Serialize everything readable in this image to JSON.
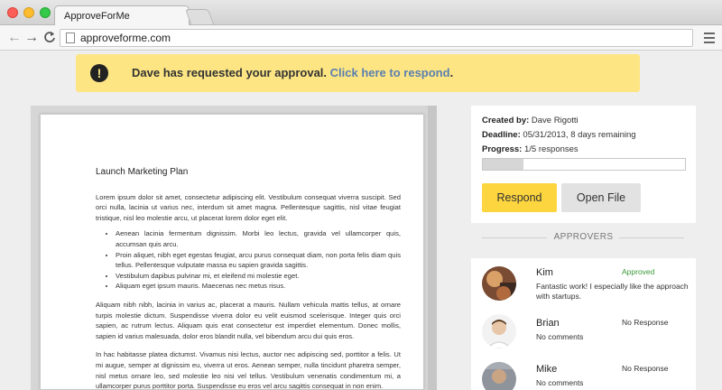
{
  "browser": {
    "tab_title": "ApproveForMe",
    "url": "approveforme.com"
  },
  "banner": {
    "text": "Dave has requested your approval. ",
    "link": "Click here to respond",
    "suffix": ".",
    "color": "#fde584"
  },
  "document": {
    "title": "Launch Marketing Plan",
    "para1": "Lorem ipsum dolor sit amet, consectetur adipiscing elit. Vestibulum consequat viverra suscipit. Sed orci nulla, lacinia ut varius nec, interdum sit amet magna. Pellentesque sagittis, nisl vitae feugiat tristique, nisl leo molestie arcu, ut placerat lorem dolor eget elit.",
    "bullets": [
      "Aenean lacinia fermentum dignissim. Morbi leo lectus, gravida vel ullamcorper quis, accumsan quis arcu.",
      "Proin aliquet, nibh eget egestas feugiat, arcu purus consequat diam, non porta felis diam quis tellus. Pellentesque vulputate massa eu sapien gravida sagittis.",
      "Vestibulum dapibus pulvinar mi, et eleifend mi molestie eget.",
      "Aliquam eget ipsum mauris. Maecenas nec metus risus."
    ],
    "para2": "Aliquam nibh nibh, lacinia in varius ac, placerat a mauris. Nullam vehicula mattis tellus, at ornare turpis molestie dictum. Suspendisse viverra dolor eu velit euismod scelerisque. Integer quis orci sapien, ac rutrum lectus. Aliquam quis erat consectetur est imperdiet elementum. Donec mollis, sapien id varius malesuada, dolor eros blandit nulla, vel bibendum arcu dui quis eros.",
    "para3": "In hac habitasse platea dictumst. Vivamus nisi lectus, auctor nec adipiscing sed, porttitor a felis. Ut mi augue, semper at dignissim eu, viverra ut eros. Aenean semper, nulla tincidunt pharetra semper, nisl metus ornare leo, sed molestie leo nisi vel tellus. Vestibulum venenatis condimentum mi, a ullamcorper purus porttitor porta. Suspendisse eu eros vel arcu sagittis consequat in non enim."
  },
  "meta": {
    "created_label": "Created by:",
    "created_value": "Dave Rigotti",
    "deadline_label": "Deadline:",
    "deadline_value": "05/31/2013, 8 days remaining",
    "progress_label": "Progress:",
    "progress_value": "1/5 responses",
    "progress_fraction": 0.2,
    "respond_label": "Respond",
    "open_label": "Open File",
    "accent": "#fdd53f"
  },
  "approvers": {
    "title": "APPROVERS",
    "items": [
      {
        "name": "Kim",
        "status": "Approved",
        "comment": "Fantastic work! I especially like the approach with startups."
      },
      {
        "name": "Brian",
        "status": "No Response",
        "comment": "No comments"
      },
      {
        "name": "Mike",
        "status": "No Response",
        "comment": "No comments"
      }
    ]
  }
}
